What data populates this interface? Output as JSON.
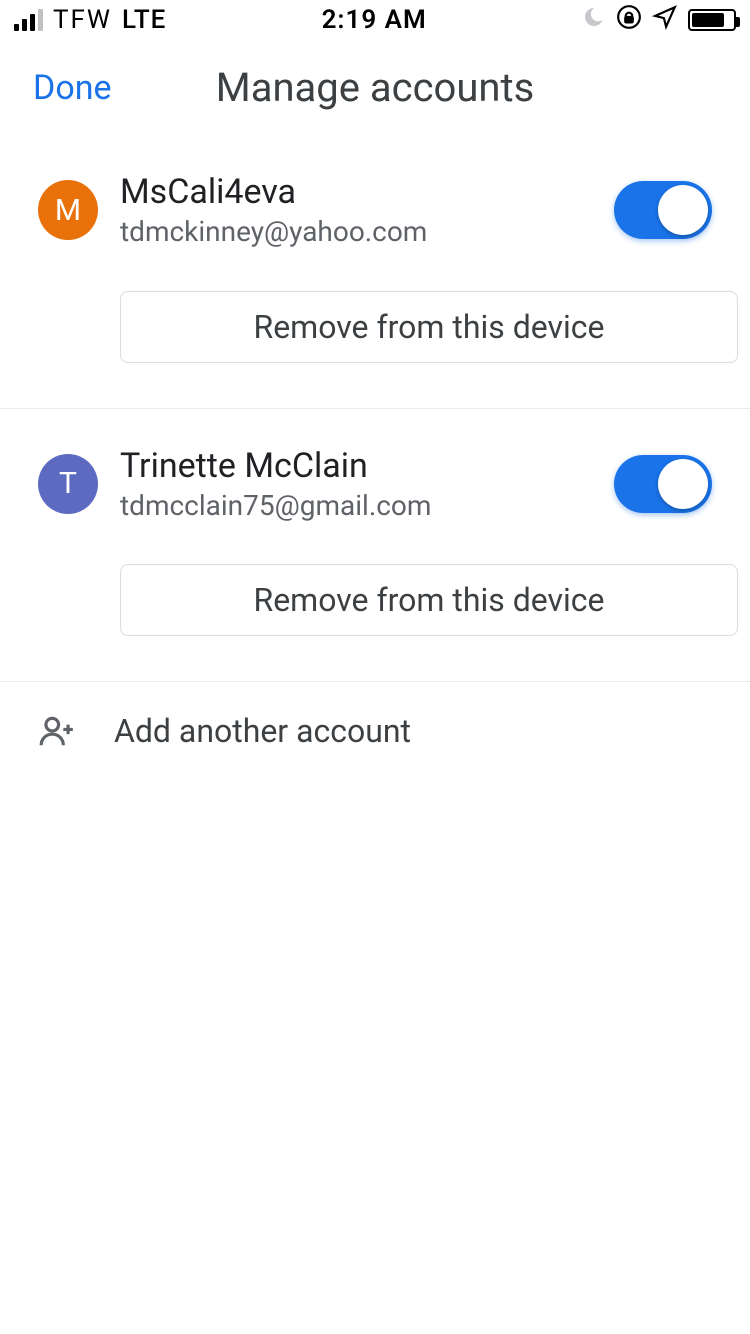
{
  "status": {
    "carrier": "TFW",
    "network": "LTE",
    "time": "2:19 AM"
  },
  "header": {
    "done": "Done",
    "title": "Manage accounts"
  },
  "accounts": [
    {
      "initial": "M",
      "avatar_color": "#e8710a",
      "name": "MsCali4eva",
      "email": "tdmckinney@yahoo.com",
      "enabled": true,
      "remove_label": "Remove from this device"
    },
    {
      "initial": "T",
      "avatar_color": "#5c6bc0",
      "name": "Trinette McClain",
      "email": "tdmcclain75@gmail.com",
      "enabled": true,
      "remove_label": "Remove from this device"
    }
  ],
  "add_label": "Add another account"
}
